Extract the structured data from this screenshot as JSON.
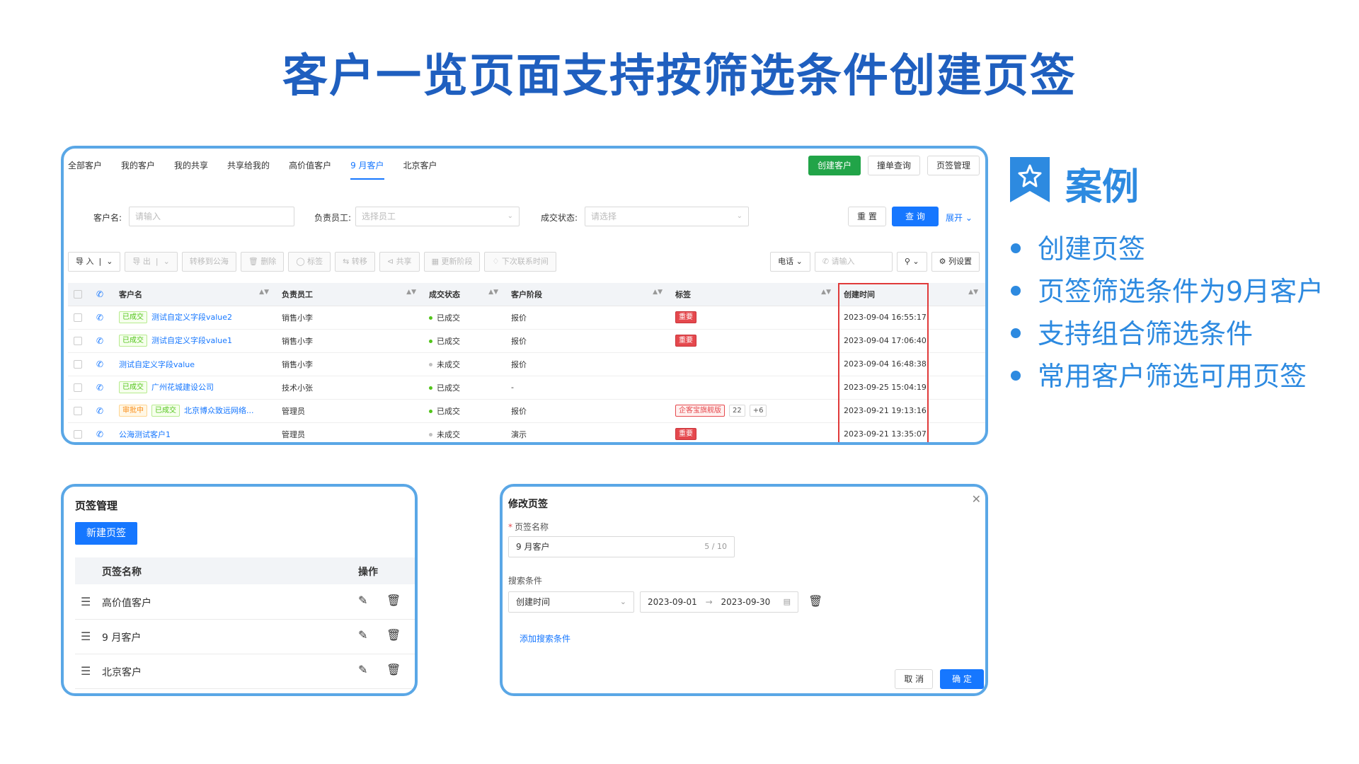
{
  "title": "客户一览页面支持按筛选条件创建页签",
  "list": {
    "tabs": [
      "全部客户",
      "我的客户",
      "我的共享",
      "共享给我的",
      "高价值客户",
      "9 月客户",
      "北京客户"
    ],
    "active_tab": "9 月客户",
    "top_buttons": {
      "create": "创建客户",
      "duplicate": "撞单查询",
      "tab_manage": "页签管理"
    },
    "filters": {
      "name_label": "客户名:",
      "name_placeholder": "请输入",
      "owner_label": "负责员工:",
      "owner_placeholder": "选择员工",
      "status_label": "成交状态:",
      "status_placeholder": "请选择",
      "reset": "重 置",
      "search": "查 询",
      "expand": "展开"
    },
    "toolbar": [
      "导 入",
      "导 出",
      "转移到公海",
      "删除",
      "标签",
      "转移",
      "共享",
      "更新阶段",
      "下次联系时间"
    ],
    "toolbar_right": {
      "phone": "电话",
      "phone_placeholder": "请输入",
      "columns": "列设置"
    },
    "columns": [
      "客户名",
      "负责员工",
      "成交状态",
      "客户阶段",
      "标签",
      "创建时间"
    ],
    "rows": [
      {
        "badges": [
          "已成交"
        ],
        "name": "测试自定义字段value2",
        "owner": "销售小李",
        "status": "已成交",
        "status_ok": true,
        "stage": "报价",
        "tags": [
          "重要"
        ],
        "created": "2023-09-04 16:55:17"
      },
      {
        "badges": [
          "已成交"
        ],
        "name": "测试自定义字段value1",
        "owner": "销售小李",
        "status": "已成交",
        "status_ok": true,
        "stage": "报价",
        "tags": [
          "重要"
        ],
        "created": "2023-09-04 17:06:40"
      },
      {
        "badges": [],
        "name": "测试自定义字段value",
        "owner": "销售小李",
        "status": "未成交",
        "status_ok": false,
        "stage": "报价",
        "tags": [],
        "created": "2023-09-04 16:48:38"
      },
      {
        "badges": [
          "已成交"
        ],
        "name": "广州花城建设公司",
        "owner": "技术小张",
        "status": "已成交",
        "status_ok": true,
        "stage": "-",
        "tags": [],
        "created": "2023-09-25 15:04:19"
      },
      {
        "badges": [
          "审批中",
          "已成交"
        ],
        "name": "北京博众致远网络...",
        "owner": "管理员",
        "status": "已成交",
        "status_ok": true,
        "stage": "报价",
        "tags": [
          "企客宝旗舰版",
          "22",
          "+6"
        ],
        "created": "2023-09-21 19:13:16"
      },
      {
        "badges": [],
        "name": "公海测试客户1",
        "owner": "管理员",
        "status": "未成交",
        "status_ok": false,
        "stage": "演示",
        "tags": [
          "重要"
        ],
        "created": "2023-09-21 13:35:07"
      }
    ]
  },
  "case": {
    "title": "案例",
    "points": [
      "创建页签",
      "页签筛选条件为9月客户",
      "支持组合筛选条件",
      "常用客户筛选可用页签"
    ]
  },
  "manage": {
    "title": "页签管理",
    "new_button": "新建页签",
    "col_name": "页签名称",
    "col_action": "操作",
    "rows": [
      "高价值客户",
      "9 月客户",
      "北京客户"
    ]
  },
  "edit": {
    "title": "修改页签",
    "name_label": "页签名称",
    "name_value": "9 月客户",
    "name_count": "5 / 10",
    "cond_label": "搜索条件",
    "cond_field": "创建时间",
    "date_start": "2023-09-01",
    "date_end": "2023-09-30",
    "add_condition": "添加搜索条件",
    "cancel": "取 消",
    "ok": "确 定"
  }
}
